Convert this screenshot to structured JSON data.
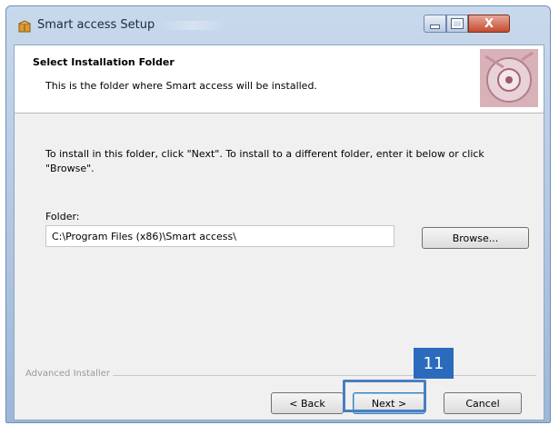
{
  "window": {
    "title": "Smart access Setup",
    "close_glyph": "X"
  },
  "header": {
    "title": "Select Installation Folder",
    "subtitle": "This is the folder where Smart access will be installed."
  },
  "body": {
    "instructions": "To install in this folder, click \"Next\". To install to a different folder, enter it below or click \"Browse\".",
    "folder_label": "Folder:",
    "folder_value": "C:\\Program Files (x86)\\Smart access\\",
    "browse_label": "Browse..."
  },
  "footer": {
    "installer_label": "Advanced Installer",
    "back_label": "< Back",
    "next_label": "Next >",
    "cancel_label": "Cancel"
  },
  "annotation": {
    "step_number": "11",
    "color": "#2a6bbd"
  },
  "icons": {
    "app": "installer-box-icon",
    "header": "installer-disc-graphic"
  }
}
